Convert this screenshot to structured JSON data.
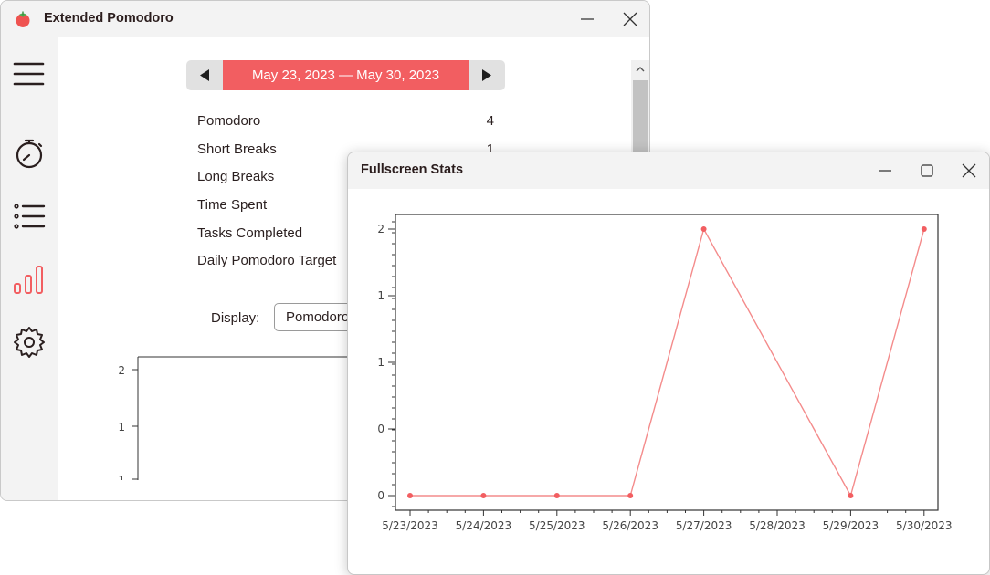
{
  "main_window": {
    "title": "Extended Pomodoro",
    "date_range": "May 23, 2023 — May 30, 2023",
    "stats": [
      {
        "label": "Pomodoro",
        "value": "4"
      },
      {
        "label": "Short Breaks",
        "value": "1"
      },
      {
        "label": "Long Breaks",
        "value": ""
      },
      {
        "label": "Time Spent",
        "value": ""
      },
      {
        "label": "Tasks Completed",
        "value": ""
      },
      {
        "label": "Daily Pomodoro Target",
        "value": ""
      }
    ],
    "display_label": "Display:",
    "display_value": "Pomodoro",
    "sidebar_icons": [
      "menu-icon",
      "timer-icon",
      "list-icon",
      "stats-icon",
      "settings-icon"
    ],
    "accent_color": "#f25e61",
    "mini_chart_ticks": [
      "2",
      "1",
      "1"
    ]
  },
  "stats_window": {
    "title": "Fullscreen Stats"
  },
  "chart_data": {
    "type": "line",
    "categories": [
      "5/23/2023",
      "5/24/2023",
      "5/25/2023",
      "5/26/2023",
      "5/27/2023",
      "5/28/2023",
      "5/29/2023",
      "5/30/2023"
    ],
    "x": [
      "5/23/2023",
      "5/24/2023",
      "5/25/2023",
      "5/26/2023",
      "5/27/2023",
      "5/29/2023",
      "5/30/2023"
    ],
    "values": [
      0,
      0,
      0,
      0,
      2,
      0,
      2
    ],
    "y_tick_labels": [
      "0",
      "0",
      "1",
      "1",
      "2"
    ],
    "ylim": [
      0,
      2
    ],
    "title": "",
    "xlabel": "",
    "ylabel": "",
    "line_color": "#f48b8b",
    "marker_color": "#f25e61",
    "grid": false
  }
}
